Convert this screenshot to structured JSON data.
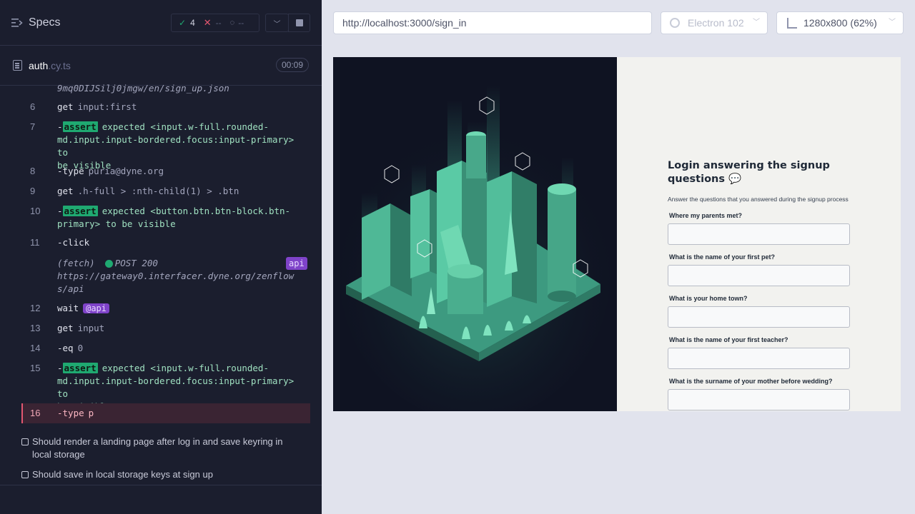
{
  "runner": {
    "title": "Specs",
    "stats": {
      "passed": "4",
      "failed": "--",
      "pending": "--"
    },
    "file": {
      "name": "auth",
      "ext": ".cy.ts",
      "time": "00:09"
    }
  },
  "commands": {
    "prev_tail": "9mq0DIJSilj0jmgw/en/sign_up.json",
    "c6": {
      "num": "6",
      "name": "get",
      "arg": "input:first"
    },
    "c7": {
      "num": "7",
      "prefix": "-",
      "badge": "assert",
      "l1": "expected <input.w-full.rounded-",
      "l2": "md.input.input-bordered.focus:input-primary>",
      "l2b": "to",
      "l3": "be",
      "l3b": "visible"
    },
    "c8": {
      "num": "8",
      "name": "-type",
      "arg": "puria@dyne.org"
    },
    "c9": {
      "num": "9",
      "name": "get",
      "arg": ".h-full > :nth-child(1) > .btn"
    },
    "c10": {
      "num": "10",
      "prefix": "-",
      "badge": "assert",
      "l1": "expected <button.btn.btn-block.btn-",
      "l2": "primary>",
      "l2b": "to be",
      "l2c": "visible"
    },
    "c11": {
      "num": "11",
      "name": "-click"
    },
    "fetch": {
      "label": "(fetch)",
      "method": "POST 200",
      "url1": "https://gateway0.interfacer.dyne.org/zenflow",
      "url2": "s/api",
      "alias": "api"
    },
    "c12": {
      "num": "12",
      "name": "wait",
      "alias": "@api"
    },
    "c13": {
      "num": "13",
      "name": "get",
      "arg": "input"
    },
    "c14": {
      "num": "14",
      "name": "-eq",
      "arg": "0"
    },
    "c15": {
      "num": "15",
      "prefix": "-",
      "badge": "assert",
      "l1": "expected <input.w-full.rounded-",
      "l2": "md.input.input-bordered.focus:input-primary>",
      "l2b": "to",
      "l3": "be",
      "l3b": "visible"
    },
    "c16": {
      "num": "16",
      "name": "-type",
      "arg": "p"
    }
  },
  "tests": [
    {
      "title": "Should render a landing page after log in and save keyring in local storage"
    },
    {
      "title": "Should save in local storage keys at sign up"
    }
  ],
  "aut": {
    "url": "http://localhost:3000/sign_in",
    "browser": "Electron 102",
    "viewport": "1280x800",
    "scale": "(62%)"
  },
  "app": {
    "title": "Login answering the signup questions 💬",
    "subtitle": "Answer the questions that you answered during the signup process",
    "questions": [
      "Where my parents met?",
      "What is the name of your first pet?",
      "What is your home town?",
      "What is the name of your first teacher?",
      "What is the surname of your mother before wedding?"
    ]
  },
  "colors": {
    "accent_green": "#1fa971",
    "fail_red": "#e45770",
    "alias_purple": "#7f43c9"
  }
}
